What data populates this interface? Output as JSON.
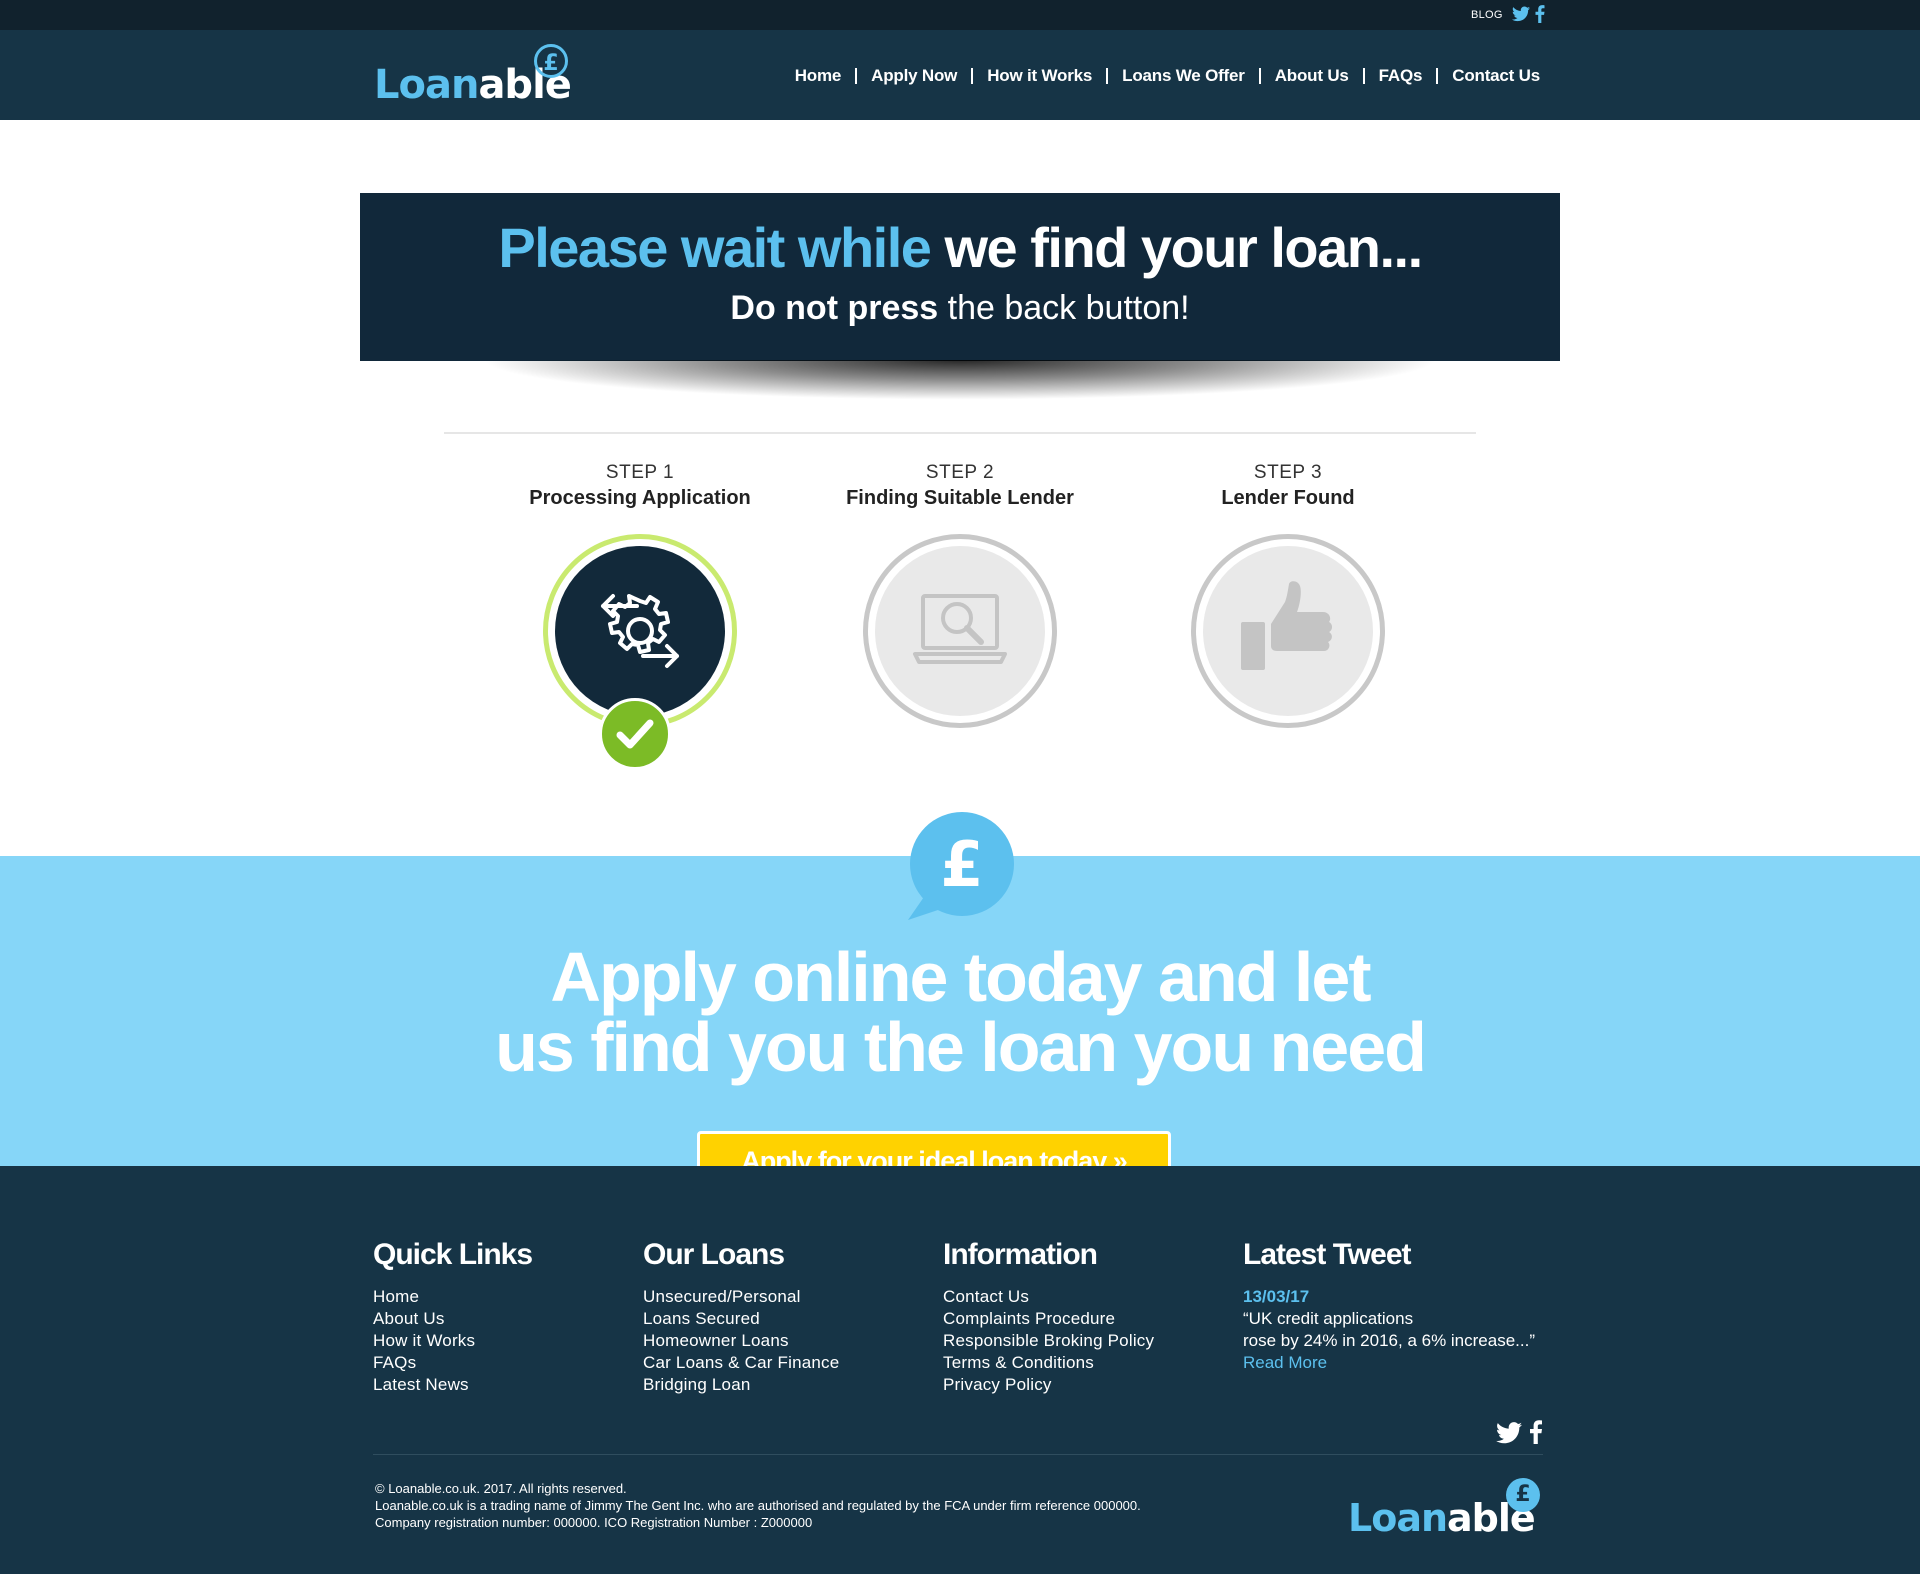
{
  "topbar": {
    "blog_label": "BLOG"
  },
  "header": {
    "logo": {
      "part1": "Loan",
      "part2": "able",
      "symbol": "£"
    },
    "nav": [
      "Home",
      "Apply Now",
      "How it Works",
      "Loans We Offer",
      "About Us",
      "FAQs",
      "Contact Us"
    ]
  },
  "banner": {
    "headline_blue": "Please wait while",
    "headline_white": " we find your loan...",
    "sub_bold": "Do not press",
    "sub_rest": " the back button!"
  },
  "steps": [
    {
      "number": "STEP 1",
      "title": "Processing Application",
      "icon": "process-gear-icon",
      "status": "complete"
    },
    {
      "number": "STEP 2",
      "title": "Finding Suitable Lender",
      "icon": "laptop-search-icon",
      "status": "pending"
    },
    {
      "number": "STEP 3",
      "title": "Lender Found",
      "icon": "thumbs-up-icon",
      "status": "pending"
    }
  ],
  "apply_band": {
    "icon_symbol": "£",
    "headline_line1": "Apply online today and let",
    "headline_line2": "us find you the loan you need",
    "cta_label": "Apply for your ideal loan today »"
  },
  "footer": {
    "quick_links": {
      "title": "Quick Links",
      "items": [
        "Home",
        "About Us",
        "How it Works",
        "FAQs",
        "Latest News"
      ]
    },
    "our_loans": {
      "title": "Our Loans",
      "items": [
        "Unsecured/Personal",
        "Loans Secured",
        "Homeowner Loans",
        "Car Loans & Car Finance",
        "Bridging Loan"
      ]
    },
    "information": {
      "title": "Information",
      "items": [
        "Contact Us",
        "Complaints Procedure",
        "Responsible Broking Policy",
        "Terms & Conditions",
        "Privacy Policy"
      ]
    },
    "latest_tweet": {
      "title": "Latest Tweet",
      "date": "13/03/17",
      "line1": "“UK credit applications",
      "line2": "rose by 24% in 2016, a 6% increase...”",
      "read_more": "Read More"
    },
    "legal": [
      "© Loanable.co.uk. 2017. All rights reserved.",
      "Loanable.co.uk is a trading name of Jimmy The Gent Inc. who are authorised and regulated by the FCA under firm reference 000000.",
      "Company registration number: 000000. ICO Registration Number : Z000000"
    ]
  },
  "colors": {
    "navy": "#163446",
    "dark_navy": "#11222d",
    "accent_blue": "#5cc0ee",
    "band_blue": "#86d6f8",
    "cta_yellow": "#ffd200",
    "check_green": "#7cbb26",
    "ring_green": "#c9ea6f"
  }
}
